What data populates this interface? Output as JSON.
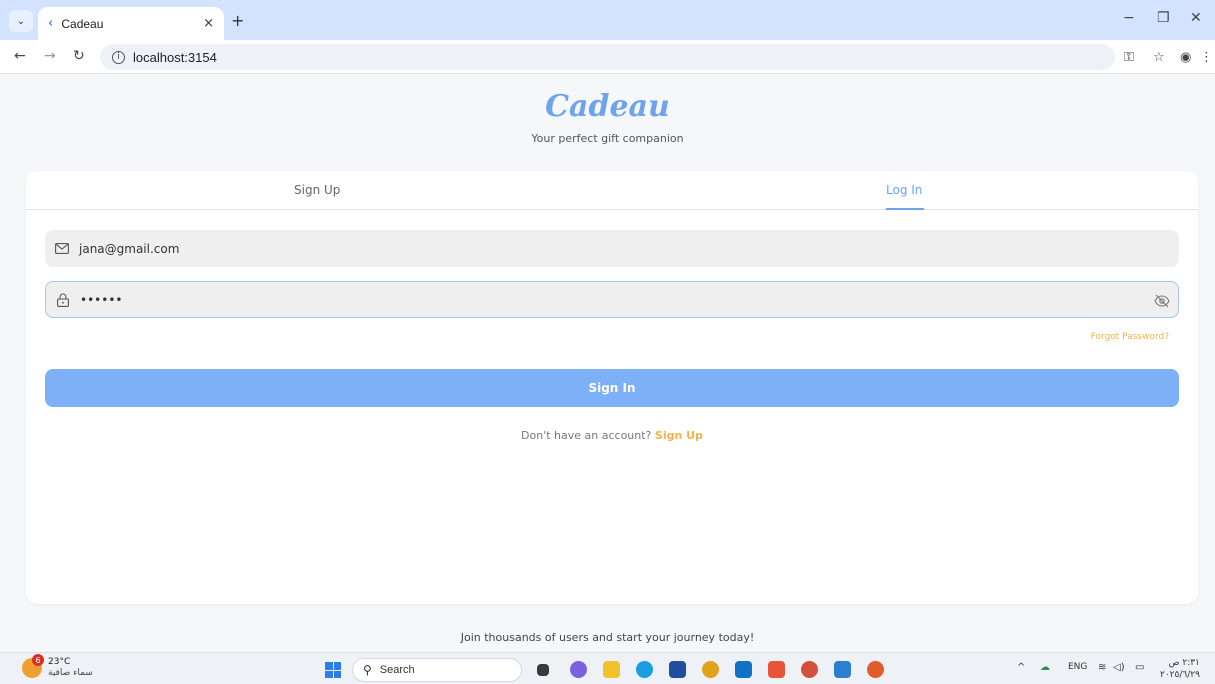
{
  "browser": {
    "tab_title": "Cadeau",
    "tab_close": "×",
    "new_tab": "+",
    "url": "localhost:3154"
  },
  "header": {
    "logo": "Cadeau",
    "tagline": "Your perfect gift companion"
  },
  "auth_tabs": [
    {
      "label": "Sign Up",
      "active": false
    },
    {
      "label": "Log In",
      "active": true
    }
  ],
  "form": {
    "email_value": "jana@gmail.com",
    "password_value": "••••••",
    "forgot_label": "Forgot Password?",
    "submit_label": "Sign In",
    "no_account_text": "Don't have an account?",
    "signup_link": "Sign Up"
  },
  "footer": {
    "text": "Join thousands of users and start your journey today!"
  },
  "taskbar": {
    "weather_badge": "6",
    "temperature": "23°C",
    "condition": "سماء صافية",
    "search_label": "Search",
    "language": "ENG",
    "time": "٢:٣١ ص",
    "date": "٢٠٢٥/٦/٢٩"
  },
  "colors": {
    "accent": "#6ea3ee",
    "button": "#7eb0f7",
    "link": "#f0b34a"
  }
}
